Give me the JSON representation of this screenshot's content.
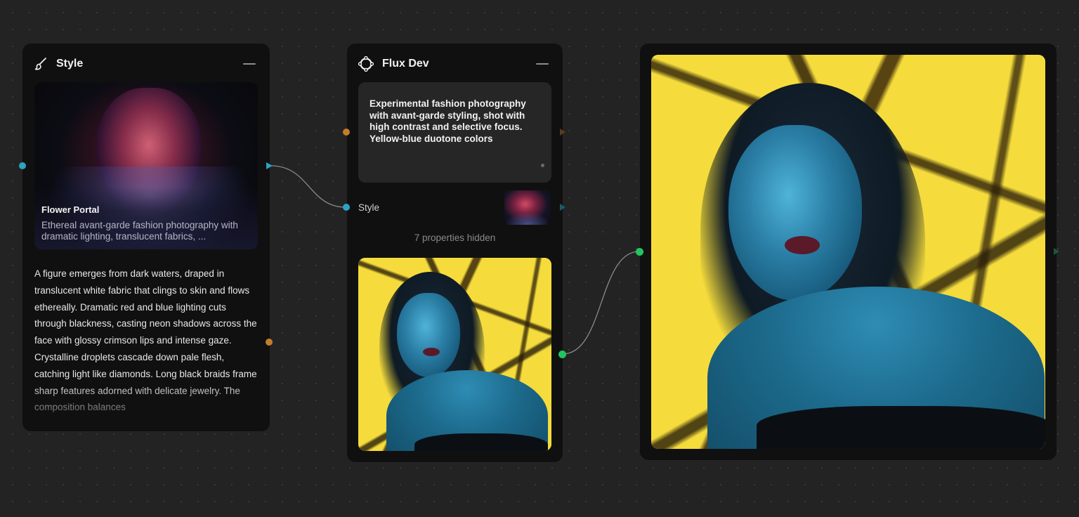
{
  "colors": {
    "canvas_bg": "#232323",
    "node_bg": "#101010",
    "cyan_handle": "#2aa3c4",
    "orange_handle": "#c47d2a",
    "green_handle": "#22c55e"
  },
  "style_node": {
    "title": "Style",
    "icon": "brush-icon",
    "card": {
      "title": "Flower Portal",
      "description": "Ethereal avant-garde fashion photography with dramatic lighting, translucent fabrics, ..."
    },
    "description": "A figure emerges from dark waters, draped in translucent white fabric that clings to skin and flows ethereally. Dramatic red and blue lighting cuts through blackness, casting neon shadows across the face with glossy crimson lips and intense gaze. Crystalline droplets cascade down pale flesh, catching light like diamonds. Long black braids frame sharp features adorned with delicate jewelry. The composition balances"
  },
  "flux_node": {
    "title": "Flux Dev",
    "icon": "flux-logo-icon",
    "prompt": "Experimental fashion photography with avant-garde styling, shot with high contrast and selective focus. Yellow-blue duotone colors",
    "style_label": "Style",
    "hidden_properties": "7 properties hidden"
  }
}
